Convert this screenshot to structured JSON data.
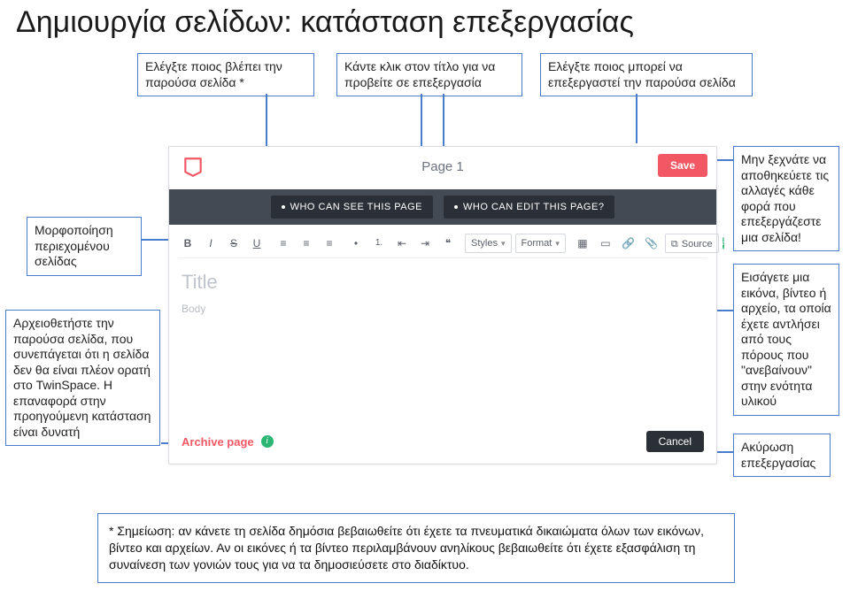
{
  "heading": "Δημιουργία σελίδων: κατάσταση επεξεργασίας",
  "callouts": {
    "top_left": "Ελέγξτε ποιος βλέπει την παρούσα σελίδα *",
    "top_mid": "Κάντε κλικ στον τίτλο για να προβείτε σε επεξεργασία",
    "top_right": "Ελέγξτε ποιος μπορεί να επεξεργαστεί την παρούσα σελίδα",
    "left_format": "Μορφοποίηση περιεχομένου σελίδας",
    "left_archive": "Αρχειοθετήστε την παρούσα σελίδα, που συνεπάγεται ότι η σελίδα δεν θα είναι πλέον ορατή στο TwinSpace. Η επαναφορά στην προηγούμενη κατάσταση είναι δυνατή",
    "right_save": "Μην ξεχνάτε να αποθηκεύετε τις αλλαγές κάθε φορά που επεξεργάζεστε μια σελίδα!",
    "right_media": "Εισάγετε μια εικόνα, βίντεο ή αρχείο, τα οποία έχετε αντλήσει από τους πόρους που \"ανεβαίνουν\" στην ενότητα υλικού",
    "right_cancel": "Ακύρωση επεξεργασίας"
  },
  "editor": {
    "page_title": "Page 1",
    "save": "Save",
    "who_see": "WHO CAN SEE THIS PAGE",
    "who_edit": "WHO CAN EDIT THIS PAGE?",
    "toolbar": {
      "bold": "B",
      "italic": "I",
      "strike": "S",
      "underline": "U",
      "align_left": "≡",
      "align_center": "≡",
      "align_right": "≡",
      "list_bullet": "•",
      "list_num": "1.",
      "outdent": "⇤",
      "indent": "⇥",
      "quote": "❝",
      "styles": "Styles",
      "format": "Format",
      "table": "▦",
      "image": "▭",
      "link": "🔗",
      "attach": "📎",
      "source": "Source"
    },
    "title_label": "Title",
    "body_label": "Body",
    "archive": "Archive page",
    "cancel": "Cancel"
  },
  "footnote": "* Σημείωση: αν κάνετε τη σελίδα δημόσια βεβαιωθείτε ότι έχετε τα πνευματικά δικαιώματα όλων των εικόνων, βίντεο και αρχείων. Αν οι εικόνες ή τα βίντεο περιλαμβάνουν ανηλίκους βεβαιωθείτε ότι έχετε εξασφάλιση τη συναίνεση των γονιών τους για να τα δημοσιεύσετε στο διαδίκτυο."
}
